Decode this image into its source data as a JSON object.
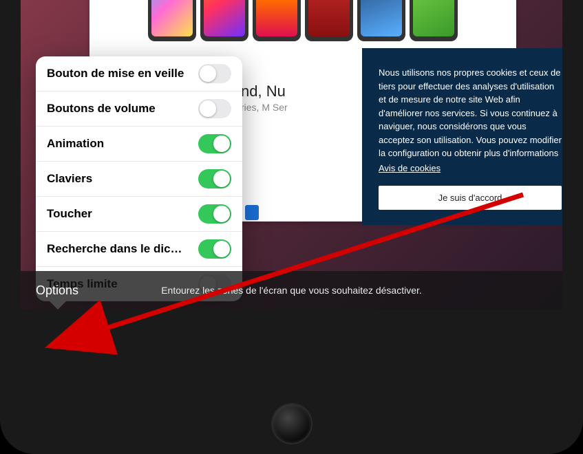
{
  "options_popover": {
    "items": [
      {
        "label": "Bouton de mise en veille",
        "state": "off"
      },
      {
        "label": "Boutons de volume",
        "state": "off"
      },
      {
        "label": "Animation",
        "state": "on"
      },
      {
        "label": "Claviers",
        "state": "on"
      },
      {
        "label": "Toucher",
        "state": "on"
      },
      {
        "label": "Recherche dans le diction...",
        "state": "on"
      },
      {
        "label": "Temps limite",
        "state": "off"
      }
    ]
  },
  "cookie_banner": {
    "text": "Nous utilisons nos propres cookies et ceux de tiers pour effectuer des analyses d'utilisation et de mesure de notre site Web afin d'améliorer nos services. Si vous continuez à naviguer, nous considérons que vous acceptez son utilisation. Vous pouvez modifier la configuration ou obtenir plus d'informations",
    "link": "Avis de cookies",
    "accept_label": "Je suis d'accord"
  },
  "web_page": {
    "title_fragment": "nd, Nu",
    "subtitle_fragment": "ries, M Ser"
  },
  "bottom_bar": {
    "options_label": "Options",
    "instructions": "Entourez les zones de l'écran que vous souhaitez désactiver."
  }
}
